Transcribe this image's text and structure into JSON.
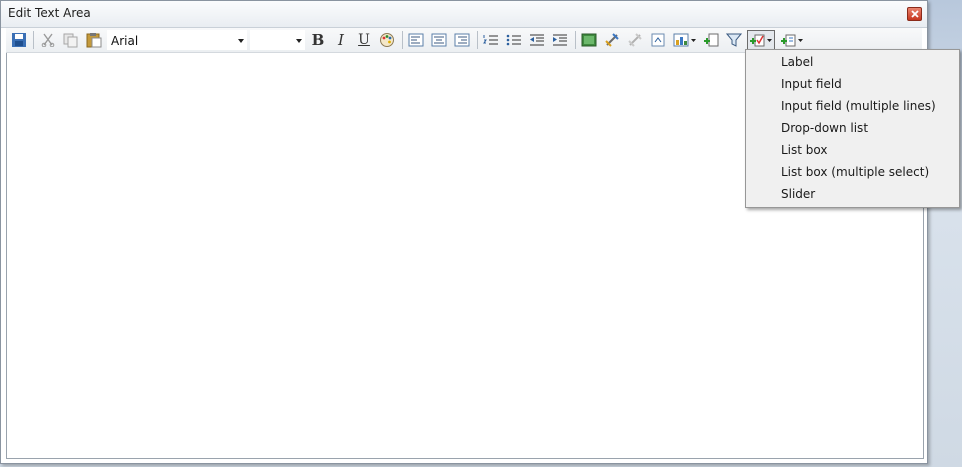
{
  "window": {
    "title": "Edit Text Area"
  },
  "toolbar": {
    "font_family": "Arial",
    "font_size": "",
    "bold_glyph": "B",
    "italic_glyph": "I",
    "underline_glyph": "U"
  },
  "insert_menu": {
    "items": [
      {
        "label": "Label"
      },
      {
        "label": "Input field"
      },
      {
        "label": "Input field (multiple lines)"
      },
      {
        "label": "Drop-down list"
      },
      {
        "label": "List box"
      },
      {
        "label": "List box (multiple select)"
      },
      {
        "label": "Slider"
      }
    ]
  },
  "colors": {
    "accent": "#2b6cb0",
    "menu_bg": "#f0f0f0",
    "close": "#c6361f"
  }
}
